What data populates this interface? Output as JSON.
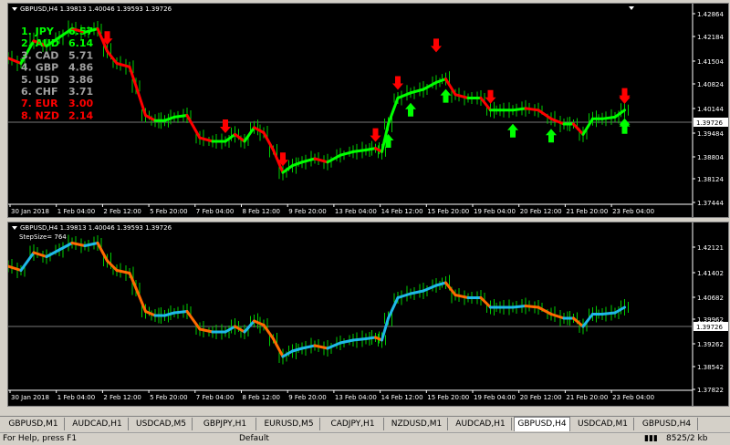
{
  "chart1": {
    "title": "GBPUSD,H4  1.39813 1.40046 1.39593 1.39726",
    "price_labels": [
      "1.42864",
      "1.42184",
      "1.41504",
      "1.40824",
      "1.40144",
      "1.39726",
      "1.39484",
      "1.38804",
      "1.38124",
      "1.37444"
    ],
    "time_labels": [
      "30 Jan 2018",
      "1 Feb 04:00",
      "2 Feb 12:00",
      "5 Feb 20:00",
      "7 Feb 04:00",
      "8 Feb 12:00",
      "9 Feb 20:00",
      "13 Feb 04:00",
      "14 Feb 12:00",
      "15 Feb 20:00",
      "19 Feb 04:00",
      "20 Feb 12:00",
      "21 Feb 20:00",
      "23 Feb 04:00"
    ],
    "strength": [
      {
        "label": "1. JPY",
        "value": "6.57",
        "color": "#00ff00"
      },
      {
        "label": "2. AUD",
        "value": "6.14",
        "color": "#00ff00"
      },
      {
        "label": "3. CAD",
        "value": "5.71",
        "color": "#a0a0a0"
      },
      {
        "label": "4. GBP",
        "value": "4.86",
        "color": "#a0a0a0"
      },
      {
        "label": "5. USD",
        "value": "3.86",
        "color": "#a0a0a0"
      },
      {
        "label": "6. CHF",
        "value": "3.71",
        "color": "#a0a0a0"
      },
      {
        "label": "7. EUR",
        "value": "3.00",
        "color": "#ff0000"
      },
      {
        "label": "8. NZD",
        "value": "2.14",
        "color": "#ff0000"
      }
    ]
  },
  "chart2": {
    "title": "GBPUSD,H4  1.39813 1.40046 1.39593 1.39726",
    "step_size": "StepSize= 764",
    "price_labels": [
      "1.42121",
      "1.41402",
      "1.40682",
      "1.39962",
      "1.39726",
      "1.39262",
      "1.38542",
      "1.37822"
    ],
    "time_labels": [
      "30 Jan 2018",
      "1 Feb 04:00",
      "2 Feb 12:00",
      "5 Feb 20:00",
      "7 Feb 04:00",
      "8 Feb 12:00",
      "9 Feb 20:00",
      "13 Feb 04:00",
      "14 Feb 12:00",
      "15 Feb 20:00",
      "19 Feb 04:00",
      "20 Feb 12:00",
      "21 Feb 20:00",
      "23 Feb 04:00"
    ]
  },
  "tabs": [
    "GBPUSD,M1",
    "AUDCAD,H1",
    "USDCAD,M5",
    "GBPJPY,H1",
    "EURUSD,M5",
    "CADJPY,H1",
    "NZDUSD,M1",
    "AUDCAD,H1",
    "GBPUSD,H4",
    "USDCAD,M1",
    "GBPUSD,H4"
  ],
  "active_tab": 8,
  "status": {
    "help": "For Help, press F1",
    "profile": "Default",
    "traffic": "8525/2 kb"
  },
  "colors": {
    "up": "#00ff00",
    "down": "#ff0000",
    "line2_up": "#1fb8e8",
    "line2_down": "#ff6a00",
    "candle": "#00cc00"
  }
}
